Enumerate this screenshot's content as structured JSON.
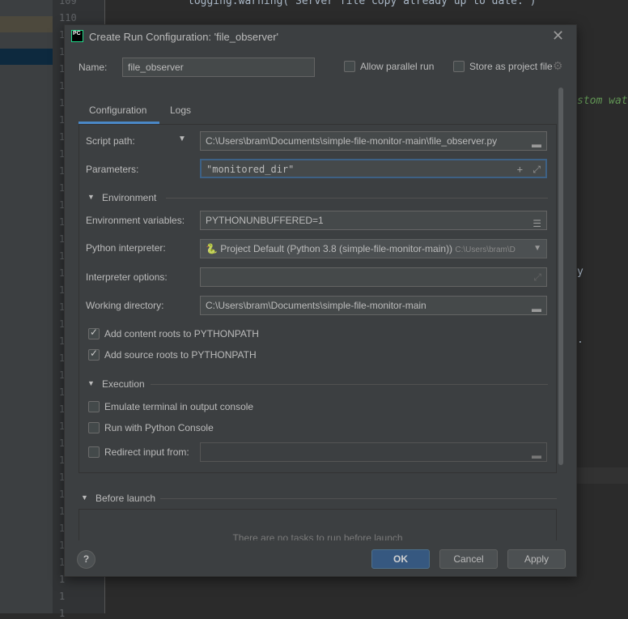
{
  "editor": {
    "line_numbers": [
      "109",
      "110",
      "1",
      "1",
      "1",
      "1",
      "1",
      "1",
      "1",
      "1",
      "1",
      "1",
      "1",
      "1",
      "1",
      "1",
      "1",
      "1",
      "1",
      "1",
      "1",
      "1",
      "1",
      "1",
      "1",
      "1",
      "1",
      "1",
      "1",
      "1",
      "1",
      "1",
      "1",
      "1",
      "1",
      "1",
      "1"
    ],
    "code_line": "logging.warning('Server file copy already up to date.')",
    "code_fragment": "stom wat",
    "fragment_y": "y",
    "fragment_dot": "."
  },
  "dialog": {
    "title": "Create Run Configuration: 'file_observer'",
    "app_icon": "PC",
    "name_label": "Name:",
    "name_value": "file_observer",
    "allow_parallel": {
      "label": "Allow parallel run",
      "checked": false
    },
    "store_project": {
      "label": "Store as project file",
      "checked": false
    },
    "tabs": [
      {
        "label": "Configuration",
        "active": true
      },
      {
        "label": "Logs",
        "active": false
      }
    ],
    "script_path_label": "Script path:",
    "script_path": "C:\\Users\\bram\\Documents\\simple-file-monitor-main\\file_observer.py",
    "parameters_label": "Parameters:",
    "parameters": "\"monitored_dir\"",
    "environment_section": "Environment",
    "env_vars_label": "Environment variables:",
    "env_vars": "PYTHONUNBUFFERED=1",
    "interpreter_label": "Python interpreter:",
    "interpreter": "Project Default (Python 3.8 (simple-file-monitor-main))",
    "interpreter_path": "C:\\Users\\bram\\D",
    "interp_options_label": "Interpreter options:",
    "interp_options": "",
    "working_dir_label": "Working directory:",
    "working_dir": "C:\\Users\\bram\\Documents\\simple-file-monitor-main",
    "add_content_roots": {
      "label": "Add content roots to PYTHONPATH",
      "checked": true
    },
    "add_source_roots": {
      "label": "Add source roots to PYTHONPATH",
      "checked": true
    },
    "execution_section": "Execution",
    "emulate_terminal": {
      "label": "Emulate terminal in output console",
      "checked": false
    },
    "run_python_console": {
      "label": "Run with Python Console",
      "checked": false
    },
    "redirect_input": {
      "label": "Redirect input from:",
      "checked": false,
      "value": ""
    },
    "before_launch_section": "Before launch",
    "before_launch_empty": "There are no tasks to run before launch",
    "buttons": {
      "help": "?",
      "ok": "OK",
      "cancel": "Cancel",
      "apply": "Apply"
    }
  },
  "colors": {
    "accent": "#4a88c7",
    "ok_button": "#365880",
    "editor_bg": "#2b2b2b",
    "dialog_bg": "#3c3f41"
  }
}
